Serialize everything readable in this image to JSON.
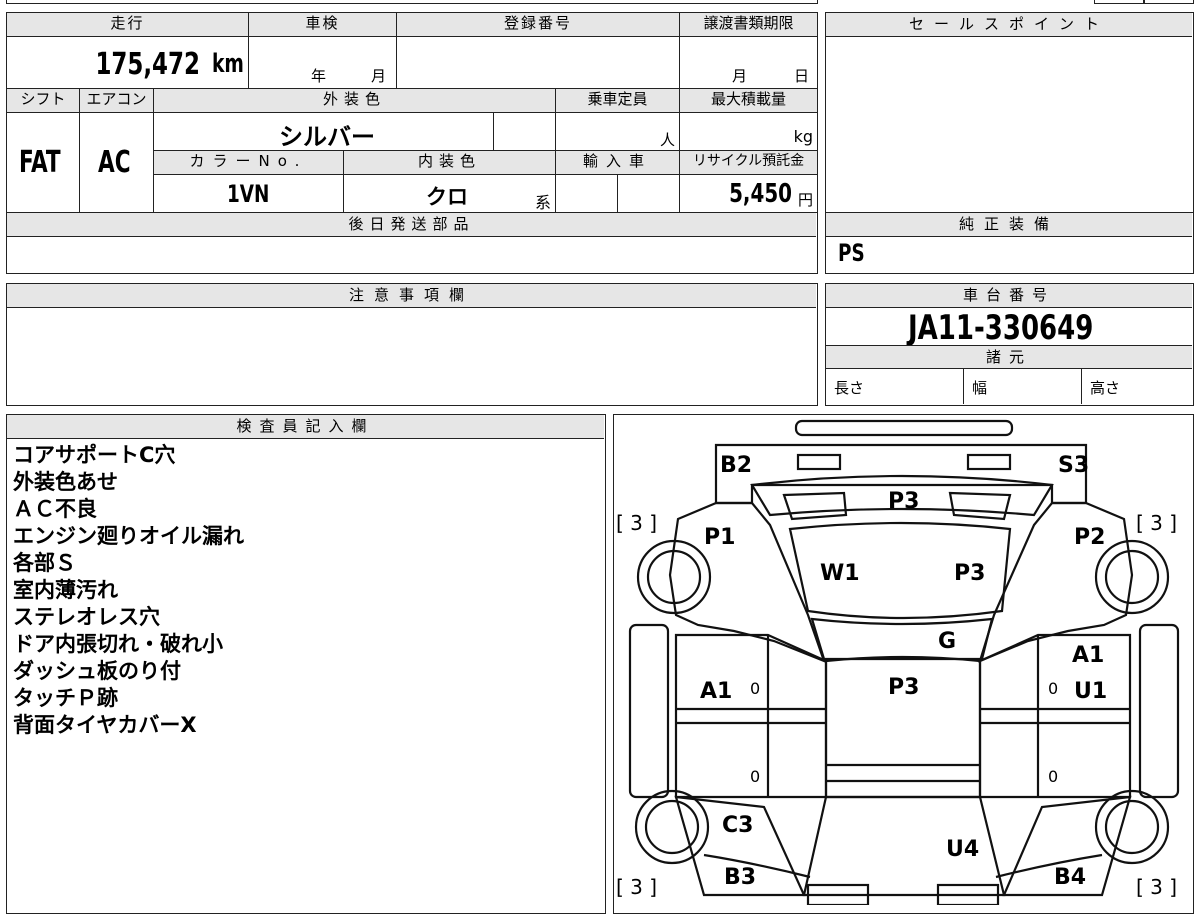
{
  "vehicle": {
    "mileage_label": "走行",
    "mileage": "175,472",
    "mileage_unit": "km",
    "inspection_label": "車検",
    "year_unit": "年",
    "month_unit": "月",
    "registration_label": "登録番号",
    "transfer_deadline_label": "譲渡書類期限",
    "day_unit": "日",
    "shift_label": "シフト",
    "shift": "FAT",
    "ac_label": "エアコン",
    "ac": "AC",
    "exterior_color_label": "外装色",
    "exterior_color": "シルバー",
    "capacity_label": "乗車定員",
    "capacity_unit": "人",
    "max_load_label": "最大積載量",
    "load_unit": "kg",
    "color_no_label": "カラーNo.",
    "color_no": "1VN",
    "interior_color_label": "内装色",
    "interior_color": "クロ",
    "interior_suffix": "系",
    "import_label": "輸入車",
    "recycle_label": "リサイクル預託金",
    "recycle_fee": "5,450",
    "yen_unit": "円",
    "later_parts_label": "後日発送部品"
  },
  "sales": {
    "sales_point_label": "セールスポイント",
    "genuine_equipment_label": "純正装備",
    "genuine_equipment": "PS"
  },
  "notes": {
    "caution_label": "注意事項欄"
  },
  "chassis": {
    "chassis_label": "車台番号",
    "chassis_number": "JA11-330649",
    "spec_label": "諸元",
    "length_label": "長さ",
    "width_label": "幅",
    "height_label": "高さ"
  },
  "inspector": {
    "label": "検査員記入欄",
    "remarks": [
      "コアサポートC穴",
      "外装色あせ",
      "ＡＣ不良",
      "エンジン廻りオイル漏れ",
      "各部Ｓ",
      "室内薄汚れ",
      "ステレオレス穴",
      "ドア内張切れ・破れ小",
      "ダッシュ板のり付",
      "タッチＰ跡",
      "背面タイヤカバーX"
    ]
  },
  "diagram": {
    "b2": "B2",
    "s3": "S3",
    "p3_bonnet": "P3",
    "p1": "P1",
    "p2": "P2",
    "w1": "W1",
    "p3_glass": "P3",
    "g": "G",
    "a1_left": "A1",
    "a1_right": "A1",
    "u1": "U1",
    "p3_roof": "P3",
    "c3": "C3",
    "u4": "U4",
    "b3": "B3",
    "b4": "B4",
    "tire_fl": "[ 3 ]",
    "tire_fr": "[ 3 ]",
    "tire_rl": "[ 3 ]",
    "tire_rr": "[ 3 ]",
    "zero_1": "0",
    "zero_2": "0",
    "zero_3": "0",
    "zero_4": "0"
  }
}
